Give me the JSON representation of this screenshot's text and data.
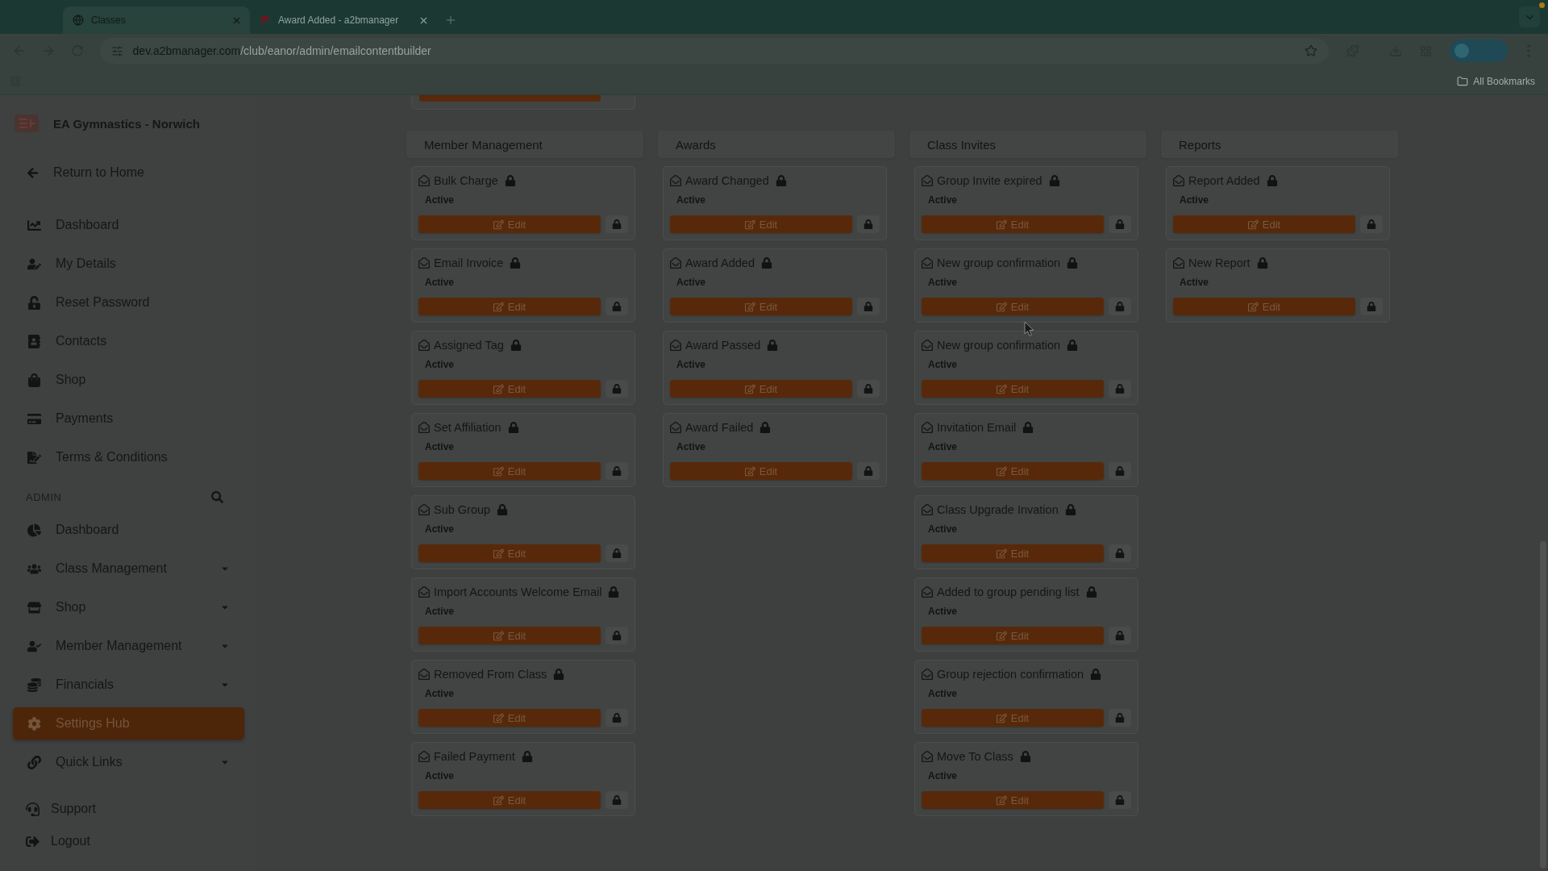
{
  "browser": {
    "tabs": [
      {
        "title": "Classes",
        "selected": true
      },
      {
        "title": "Award Added - a2bmanager",
        "selected": false
      }
    ],
    "url": "dev.a2bmanager.com/club/eanor/admin/emailcontentbuilder",
    "bookmarks_label": "All Bookmarks"
  },
  "sidebar": {
    "club_name": "EA Gymnastics - Norwich",
    "return_link": "Return to Home",
    "menu": [
      {
        "label": "Dashboard",
        "selected": false
      },
      {
        "label": "My Details",
        "selected": false
      },
      {
        "label": "Reset Password",
        "selected": false
      },
      {
        "label": "Contacts",
        "selected": false
      },
      {
        "label": "Shop",
        "selected": false
      },
      {
        "label": "Payments",
        "selected": false
      },
      {
        "label": "Terms & Conditions",
        "selected": false
      }
    ],
    "admin_heading": "ADMIN",
    "admin_menu": [
      {
        "label": "Dashboard",
        "expandable": false,
        "selected": false
      },
      {
        "label": "Class Management",
        "expandable": true,
        "selected": false
      },
      {
        "label": "Shop",
        "expandable": true,
        "selected": false
      },
      {
        "label": "Member Management",
        "expandable": true,
        "selected": false
      },
      {
        "label": "Financials",
        "expandable": true,
        "selected": false
      },
      {
        "label": "Settings Hub",
        "expandable": false,
        "selected": true
      },
      {
        "label": "Quick Links",
        "expandable": true,
        "selected": false
      }
    ],
    "footer_links": [
      "Support",
      "Logout"
    ]
  },
  "content": {
    "top_card_cut": true,
    "sections": [
      {
        "title": "Member Management",
        "templates": [
          {
            "name": "Bulk Charge",
            "status": "Active",
            "button": "Edit"
          },
          {
            "name": "Email Invoice",
            "status": "Active",
            "button": "Edit"
          },
          {
            "name": "Assigned Tag",
            "status": "Active",
            "button": "Edit"
          },
          {
            "name": "Set Affiliation",
            "status": "Active",
            "button": "Edit"
          },
          {
            "name": "Sub Group",
            "status": "Active",
            "button": "Edit"
          },
          {
            "name": "Import Accounts Welcome Email",
            "status": "Active",
            "button": "Edit"
          },
          {
            "name": "Removed From Class",
            "status": "Active",
            "button": "Edit"
          },
          {
            "name": "Failed Payment",
            "status": "Active",
            "button": "Edit"
          }
        ]
      },
      {
        "title": "Awards",
        "templates": [
          {
            "name": "Award Changed",
            "status": "Active",
            "button": "Edit"
          },
          {
            "name": "Award Added",
            "status": "Active",
            "button": "Edit"
          },
          {
            "name": "Award Passed",
            "status": "Active",
            "button": "Edit"
          },
          {
            "name": "Award Failed",
            "status": "Active",
            "button": "Edit"
          }
        ]
      },
      {
        "title": "Class Invites",
        "templates": [
          {
            "name": "Group Invite expired",
            "status": "Active",
            "button": "Edit"
          },
          {
            "name": "New group confirmation",
            "status": "Active",
            "button": "Edit"
          },
          {
            "name": "New group confirmation",
            "status": "Active",
            "button": "Edit"
          },
          {
            "name": "Invitation Email",
            "status": "Active",
            "button": "Edit"
          },
          {
            "name": "Class Upgrade Invation",
            "status": "Active",
            "button": "Edit"
          },
          {
            "name": "Added to group pending list",
            "status": "Active",
            "button": "Edit"
          },
          {
            "name": "Group rejection confirmation",
            "status": "Active",
            "button": "Edit"
          },
          {
            "name": "Move To Class",
            "status": "Active",
            "button": "Edit"
          }
        ]
      },
      {
        "title": "Reports",
        "templates": [
          {
            "name": "Report Added",
            "status": "Active",
            "button": "Edit"
          },
          {
            "name": "New Report",
            "status": "Active",
            "button": "Edit"
          }
        ]
      }
    ]
  }
}
